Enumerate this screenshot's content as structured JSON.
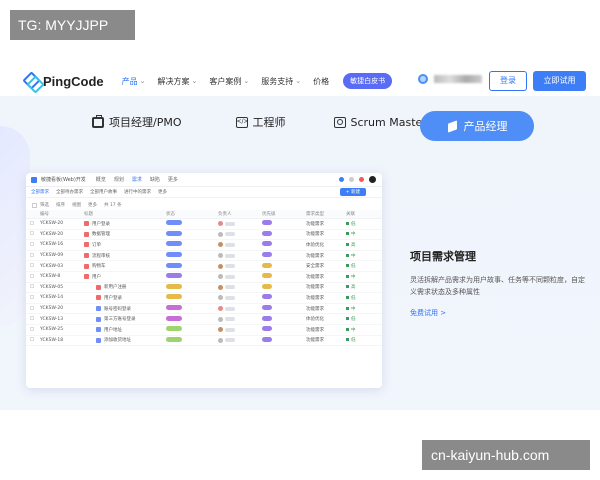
{
  "tag": "TG: MYYJJPP",
  "source": "cn-kaiyun-hub.com",
  "nav": {
    "logo": "PingCode",
    "menu": [
      {
        "label": "产品",
        "dropdown": true,
        "active": true
      },
      {
        "label": "解决方案",
        "dropdown": true,
        "active": false
      },
      {
        "label": "客户案例",
        "dropdown": true,
        "active": false
      },
      {
        "label": "服务支持",
        "dropdown": true,
        "active": false
      },
      {
        "label": "价格",
        "dropdown": false,
        "active": false
      }
    ],
    "whitepaper": "敏捷白皮书",
    "login": "登录",
    "trial": "立即试用"
  },
  "roles": [
    {
      "label": "项目经理/PMO",
      "icon": "briefcase-icon"
    },
    {
      "label": "工程师",
      "icon": "code-icon"
    },
    {
      "label": "Scrum Master",
      "icon": "scrum-icon"
    },
    {
      "label": "产品经理",
      "icon": "cube-icon",
      "active": true
    }
  ],
  "app": {
    "title": "敏捷看板(Web)开发",
    "tabs": [
      "概览",
      "规划",
      "需求",
      "缺陷",
      "更多"
    ],
    "active_tab": "需求",
    "subtabs": [
      "全部需求",
      "全部待办需求",
      "全部用户故事",
      "进行中的需求",
      "更多"
    ],
    "new_button": "+ 新建",
    "toolbar": [
      "筛选",
      "排序",
      "视图",
      "更多",
      "共 17 条"
    ],
    "columns": [
      "编号",
      "标题",
      "状态",
      "负责人",
      "优先级",
      "需求类型",
      "关联"
    ],
    "rows": [
      {
        "id": "YCKSW-20",
        "title": "用户登录",
        "status_color": "#6f8ef7",
        "type_icon": "#f06a6a",
        "avatar": "#e58a8a",
        "priority_color": "#9a7de8",
        "req_type": "功能需求",
        "level": "低"
      },
      {
        "id": "YCKSW-20",
        "title": "数据管理",
        "status_color": "#6f8ef7",
        "type_icon": "#f06a6a",
        "avatar": "#bbb",
        "priority_color": "#9a7de8",
        "req_type": "功能需求",
        "level": "中"
      },
      {
        "id": "YCKSW-16",
        "title": "订单",
        "status_color": "#6f8ef7",
        "type_icon": "#f06a6a",
        "avatar": "#c49068",
        "priority_color": "#9a7de8",
        "req_type": "体验优化",
        "level": "高"
      },
      {
        "id": "YCKSW-09",
        "title": "流程审核",
        "status_color": "#6f8ef7",
        "type_icon": "#f06a6a",
        "avatar": "#bbb",
        "priority_color": "#9a7de8",
        "req_type": "功能需求",
        "level": "中"
      },
      {
        "id": "YCKSW-03",
        "title": "购物车",
        "status_color": "#6f8ef7",
        "type_icon": "#f06a6a",
        "avatar": "#c49068",
        "priority_color": "#e6b94b",
        "req_type": "安全需求",
        "level": "低"
      },
      {
        "id": "YCKSW-8",
        "title": "用户",
        "status_color": "#9a7de8",
        "type_icon": "#f06a6a",
        "avatar": "#bbb",
        "priority_color": "#e6b94b",
        "req_type": "功能需求",
        "level": "中"
      },
      {
        "id": "YCKSW-05",
        "title": "新用户注册",
        "status_color": "#e6b94b",
        "type_icon": "#f06a6a",
        "avatar": "#c49068",
        "priority_color": "#e6b94b",
        "req_type": "功能需求",
        "level": "高"
      },
      {
        "id": "YCKSW-14",
        "title": "用户登录",
        "status_color": "#e6b94b",
        "type_icon": "#f06a6a",
        "avatar": "#bbb",
        "priority_color": "#9a7de8",
        "req_type": "功能需求",
        "level": "低"
      },
      {
        "id": "YCKSW-20",
        "title": "账号密码登录",
        "status_color": "#c86dd8",
        "type_icon": "#6f8ef7",
        "avatar": "#e58a8a",
        "priority_color": "#9a7de8",
        "req_type": "功能需求",
        "level": "中"
      },
      {
        "id": "YCKSW-13",
        "title": "第三方账号登录",
        "status_color": "#c86dd8",
        "type_icon": "#6f8ef7",
        "avatar": "#bbb",
        "priority_color": "#9a7de8",
        "req_type": "体验优化",
        "level": "低"
      },
      {
        "id": "YCKSW-25",
        "title": "用户地址",
        "status_color": "#9fd36f",
        "type_icon": "#6f8ef7",
        "avatar": "#c49068",
        "priority_color": "#9a7de8",
        "req_type": "功能需求",
        "level": "中"
      },
      {
        "id": "YCKSW-18",
        "title": "添加收货地址",
        "status_color": "#9fd36f",
        "type_icon": "#6f8ef7",
        "avatar": "#bbb",
        "priority_color": "#9a7de8",
        "req_type": "功能需求",
        "level": "低"
      }
    ]
  },
  "feature": {
    "title": "项目需求管理",
    "desc": "灵活拆解产品需求为用户故事、任务等不同颗粒度，自定义需求状态及多种属性",
    "link": "免费试用 >"
  },
  "colors": {
    "accent": "#2f74f5",
    "hero_bg": "#f0f4fb",
    "active_role": "#4f8ef7"
  }
}
